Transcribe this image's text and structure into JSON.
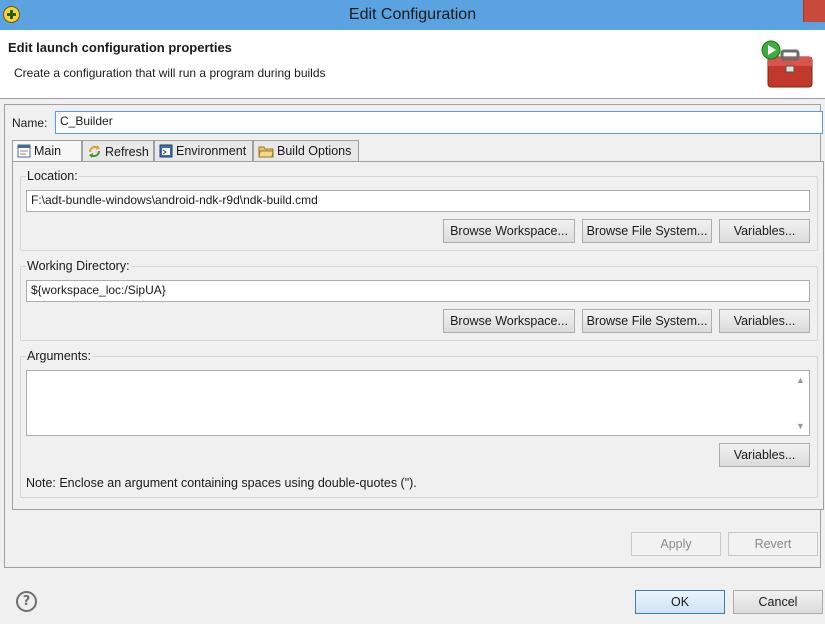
{
  "window": {
    "title": "Edit Configuration"
  },
  "header": {
    "title": "Edit launch configuration properties",
    "description": "Create a configuration that will run a program during builds"
  },
  "name_field": {
    "label": "Name:",
    "value": "C_Builder"
  },
  "tabs": [
    {
      "label": "Main",
      "icon": "main-tab-icon",
      "active": true
    },
    {
      "label": "Refresh",
      "icon": "refresh-icon",
      "active": false
    },
    {
      "label": "Environment",
      "icon": "environment-icon",
      "active": false
    },
    {
      "label": "Build Options",
      "icon": "folder-icon",
      "active": false
    }
  ],
  "location": {
    "label": "Location:",
    "value": "F:\\adt-bundle-windows\\android-ndk-r9d\\ndk-build.cmd",
    "buttons": {
      "workspace": "Browse Workspace...",
      "filesystem": "Browse File System...",
      "variables": "Variables..."
    }
  },
  "working_directory": {
    "label": "Working Directory:",
    "value": "${workspace_loc:/SipUA}",
    "buttons": {
      "workspace": "Browse Workspace...",
      "filesystem": "Browse File System...",
      "variables": "Variables..."
    }
  },
  "arguments": {
    "label": "Arguments:",
    "value": "",
    "variables_button": "Variables...",
    "note": "Note: Enclose an argument containing spaces using double-quotes (\")."
  },
  "actions": {
    "apply": "Apply",
    "revert": "Revert",
    "ok": "OK",
    "cancel": "Cancel",
    "help": "?"
  },
  "colors": {
    "titlebar": "#5ba3e0",
    "focus_border": "#569de5",
    "panel_bg": "#f0f0f0"
  }
}
